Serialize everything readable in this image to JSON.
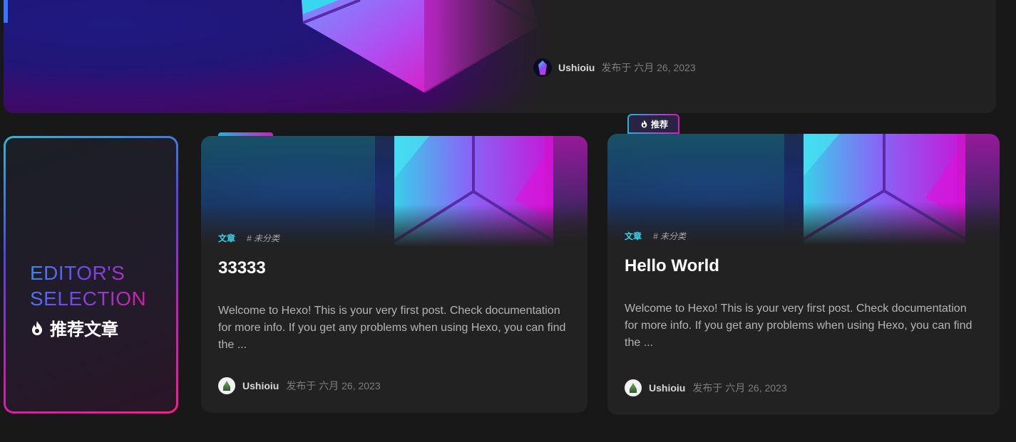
{
  "hero": {
    "author": "Ushioiu",
    "date": "发布于 六月 26, 2023"
  },
  "editor": {
    "title_line1": "EDITOR'S",
    "title_line2": "SELECTION",
    "subtitle": "推荐文章"
  },
  "badge": {
    "label": "推荐"
  },
  "posts": [
    {
      "category": "文章",
      "tag": "# 未分类",
      "title": "33333",
      "excerpt": "Welcome to Hexo! This is your very first post. Check documentation for more info. If you get any problems when using Hexo, you can find the ...",
      "author": "Ushioiu",
      "date": "发布于 六月 26, 2023"
    },
    {
      "category": "文章",
      "tag": "# 未分类",
      "title": "Hello World",
      "excerpt": "Welcome to Hexo! This is your very first post. Check documentation for more info. If you get any problems when using Hexo, you can find the ...",
      "author": "Ushioiu",
      "date": "发布于 六月 26, 2023"
    }
  ],
  "colors": {
    "background": "#181818",
    "card": "#222222",
    "accent_cyan": "#3fd4e8",
    "accent_magenta": "#ff1a90",
    "accent_purple": "#5046e8"
  },
  "icons": {
    "flame": "flame-icon",
    "gem": "gem-logo-icon"
  }
}
